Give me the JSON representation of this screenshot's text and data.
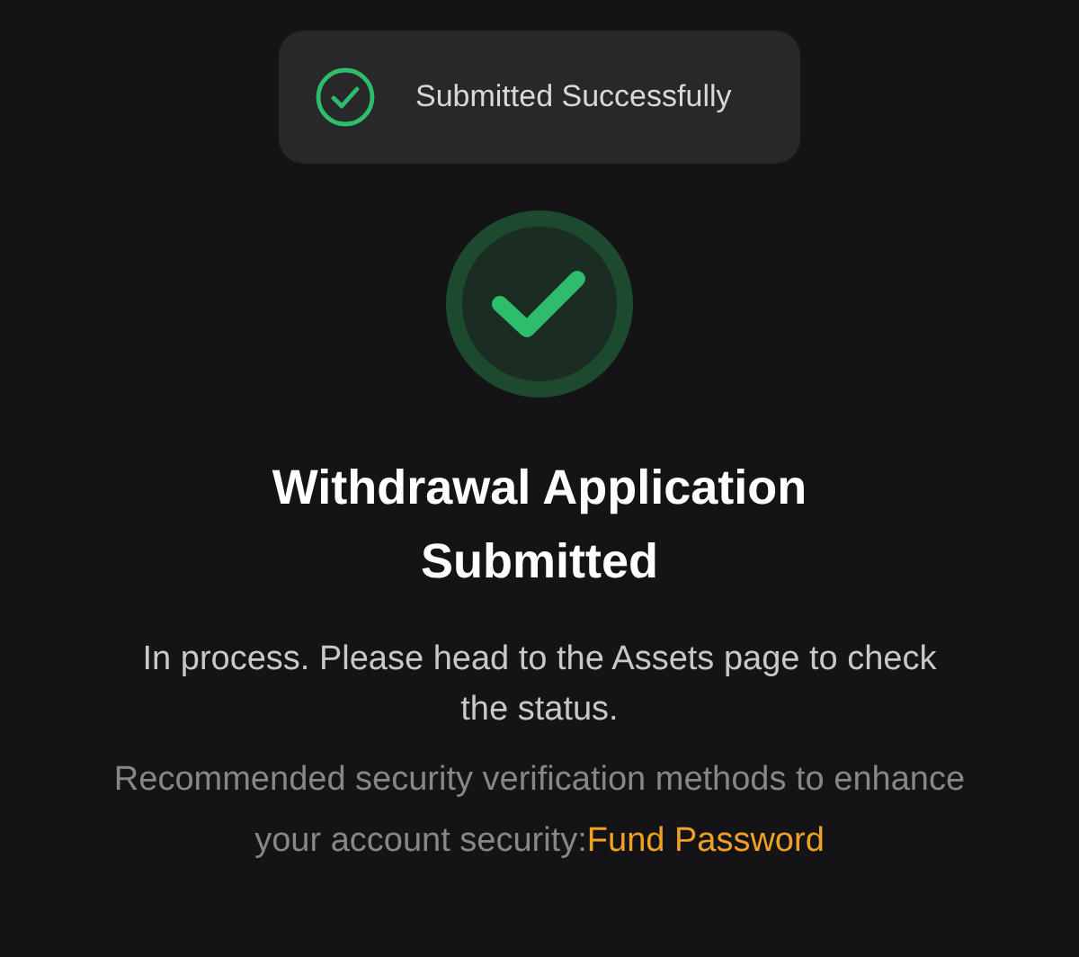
{
  "toast": {
    "text": "Submitted Successfully"
  },
  "result": {
    "title": "Withdrawal Application Submitted",
    "message": "In process. Please head to the Assets page to check the status."
  },
  "recommendation": {
    "text": "Recommended security verification methods to enhance your account security:",
    "link": "Fund Password"
  }
}
